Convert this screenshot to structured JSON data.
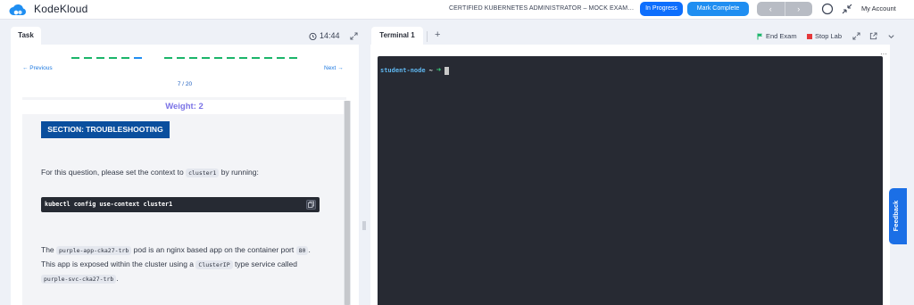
{
  "header": {
    "brand": "KodeKloud",
    "exam_title": "CERTIFIED KUBERNETES ADMINISTRATOR – MOCK EXAM SE...",
    "status_button": "In Progress",
    "complete_button": "Mark Complete",
    "prev_arrow": "‹",
    "next_arrow": "›",
    "account_label": "My Account",
    "brand_color": "#1f8ef1"
  },
  "task_panel": {
    "tab_label": "Task",
    "timer": "14:44",
    "progress_colors": {
      "done": "#1bb56a",
      "current": "#1f8ef1"
    },
    "prev_label": "← Previous",
    "next_label": "Next →",
    "counter": "7 / 20",
    "weight": "Weight: 2",
    "section": "SECTION: TROUBLESHOOTING",
    "para1": {
      "before": "For this question, please set the context to ",
      "code": "cluster1",
      "after": " by running:"
    },
    "command": "kubectl config use-context cluster1",
    "para2": {
      "t1": "The ",
      "c1": "purple-app-cka27-trb",
      "t2": " pod is an nginx based app on the container port ",
      "c2": "80",
      "t3": ". This app is exposed within the cluster using a ",
      "c3": "ClusterIP",
      "t4": " type service called ",
      "c4": "purple-svc-cka27-trb",
      "t5": "."
    }
  },
  "terminal_panel": {
    "tab_label": "Terminal 1",
    "add_tab": "+",
    "end_exam": "End Exam",
    "stop_lab": "Stop Lab",
    "prompt_host": "student-node",
    "prompt_dir": "~",
    "prompt_arrow": "➜",
    "more": "···"
  },
  "feedback": {
    "label": "Feedback"
  }
}
